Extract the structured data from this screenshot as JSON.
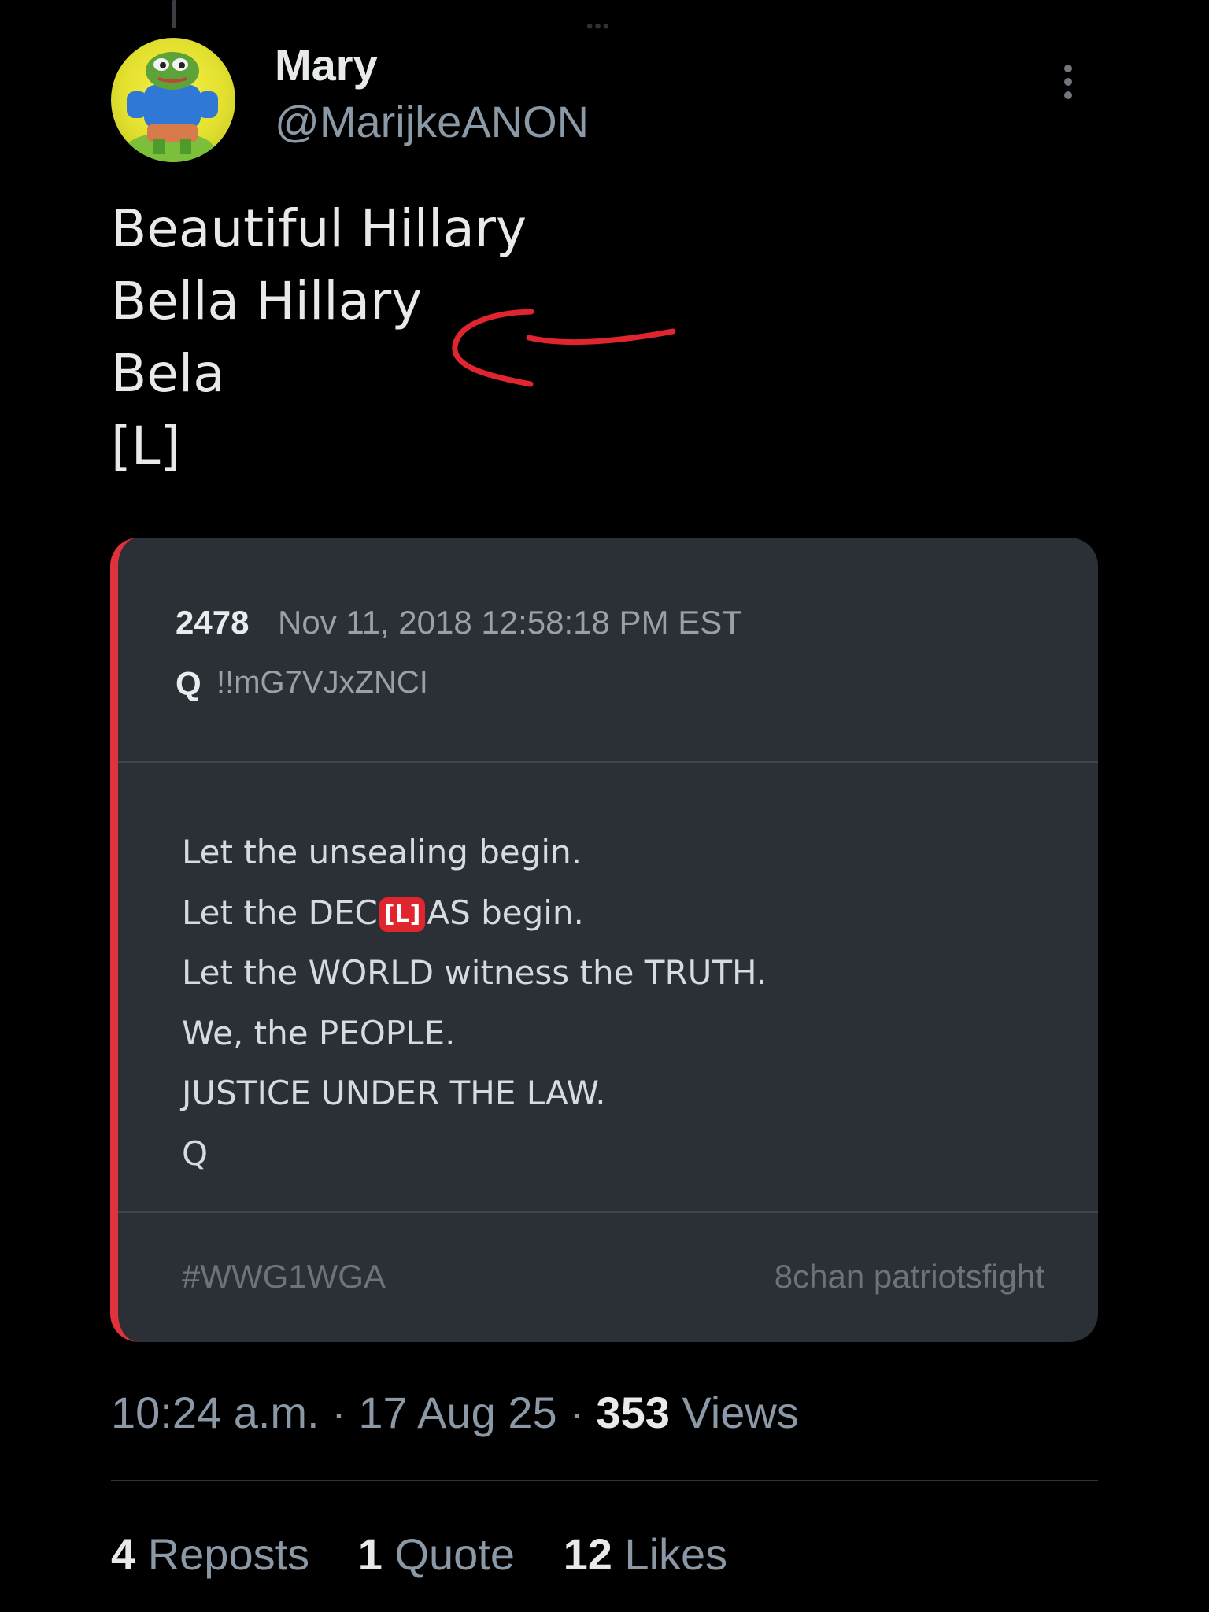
{
  "tweet": {
    "author": {
      "name": "Mary",
      "handle": "@MarijkeANON",
      "avatar_icon": "pepe-frog-avatar"
    },
    "text_lines": [
      "Beautiful Hillary",
      "Bella Hillary",
      "Bela",
      "[L]"
    ],
    "annotation": {
      "icon": "hand-drawn-red-arrow",
      "color": "#e0252f"
    }
  },
  "quoted_post": {
    "number": "2478",
    "date": "Nov 11, 2018 12:58:18 PM EST",
    "author": "Q",
    "tripcode": "!!mG7VJxZNCI",
    "accent_color": "#e0323c",
    "lines": {
      "l1": "Let the unsealing begin.",
      "l2_prefix": "Let the DEC",
      "l2_badge": "[L]",
      "l2_suffix": "AS begin.",
      "l3": "Let the WORLD witness the TRUTH.",
      "l4": "We, the PEOPLE.",
      "l5": "JUSTICE UNDER THE LAW.",
      "l6": "Q"
    },
    "hashtag": "#WWG1WGA",
    "source": "8chan patriotsfight"
  },
  "meta": {
    "time": "10:24 a.m.",
    "date": "17 Aug 25",
    "views_count": "353",
    "views_label": "Views",
    "separator": "·"
  },
  "stats": {
    "reposts_count": "4",
    "reposts_label": "Reposts",
    "quotes_count": "1",
    "quotes_label": "Quote",
    "likes_count": "12",
    "likes_label": "Likes"
  }
}
